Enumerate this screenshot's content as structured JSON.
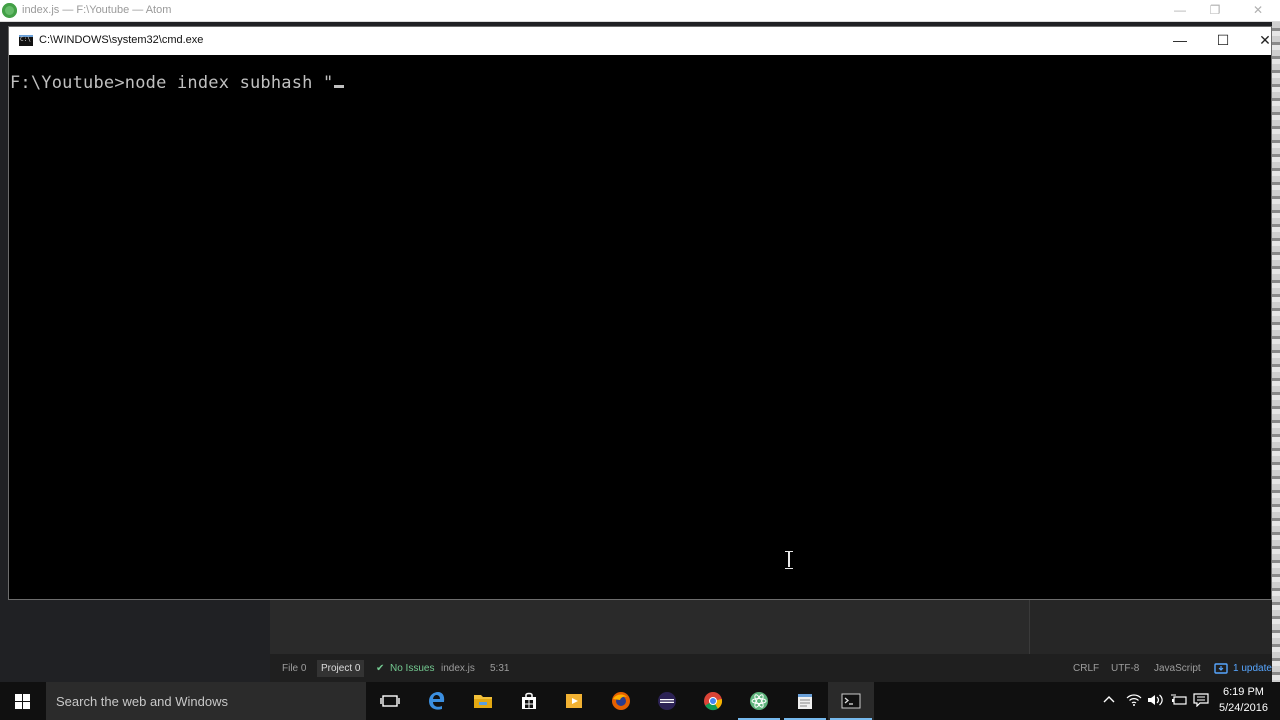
{
  "atom": {
    "window_title": "index.js — F:\\Youtube — Atom",
    "minimize": "—",
    "restore": "❐",
    "close": "✕"
  },
  "cmd": {
    "title": "C:\\WINDOWS\\system32\\cmd.exe",
    "command_line": "F:\\Youtube>node index subhash \"",
    "minimize": "—",
    "maximize": "☐",
    "close": "✕"
  },
  "statusbar": {
    "file": "File 0",
    "project": "Project 0",
    "issues_icon": "✔",
    "issues": "No Issues",
    "filename": "index.js",
    "position": "5:31",
    "line_ending": "CRLF",
    "encoding": "UTF-8",
    "grammar": "JavaScript",
    "update": "1 update"
  },
  "taskbar": {
    "search_placeholder": "Search the web and Windows",
    "apps": [
      {
        "name": "task-view-icon"
      },
      {
        "name": "edge-icon"
      },
      {
        "name": "file-explorer-icon"
      },
      {
        "name": "store-icon"
      },
      {
        "name": "media-player-icon"
      },
      {
        "name": "firefox-icon"
      },
      {
        "name": "eclipse-icon"
      },
      {
        "name": "chrome-icon"
      },
      {
        "name": "atom-icon"
      },
      {
        "name": "notepad-icon"
      },
      {
        "name": "cmd-icon"
      }
    ],
    "clock_time": "6:19 PM",
    "clock_date": "5/24/2016"
  },
  "colors": {
    "accent": "#76b9ed",
    "console_text": "#c0c0c0"
  }
}
